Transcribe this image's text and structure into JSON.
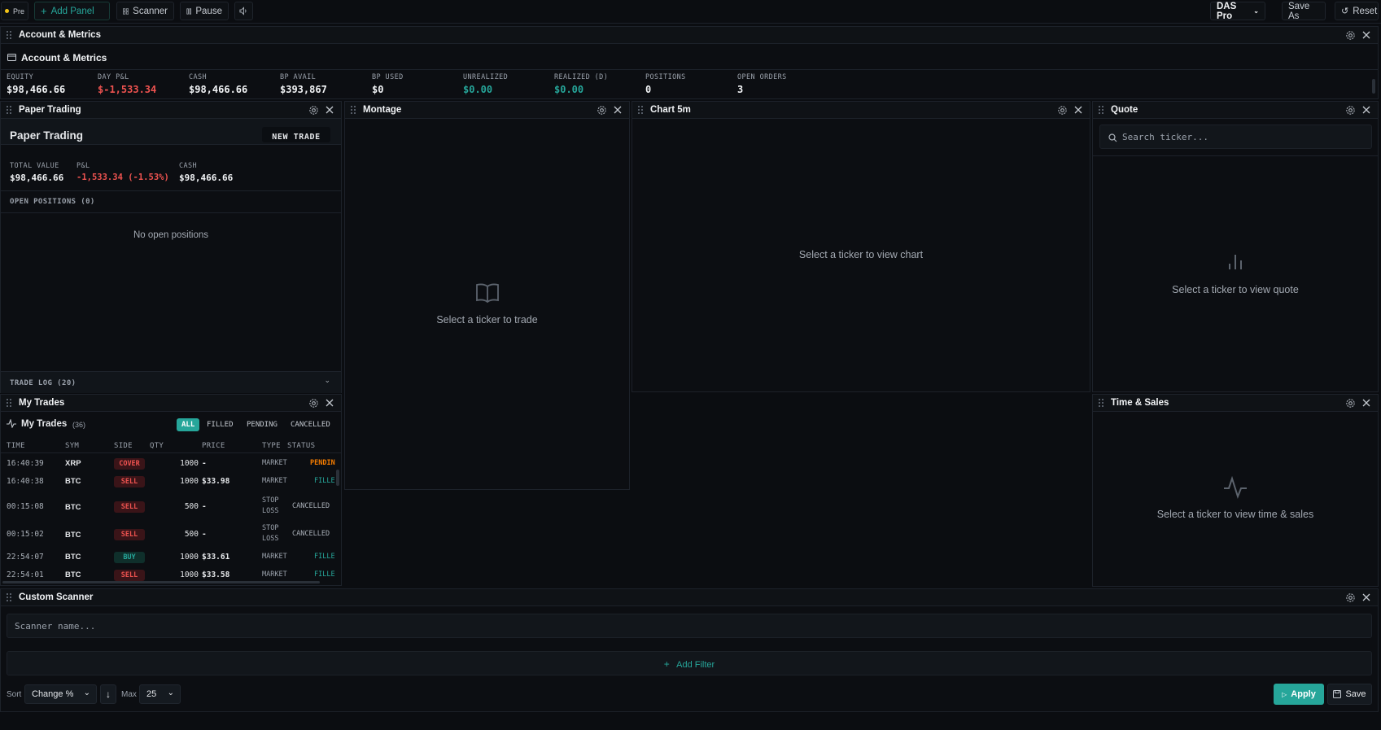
{
  "topbar": {
    "session": "Pre",
    "add_panel": "Add Panel",
    "scanner": "Scanner",
    "pause": "Pause",
    "layout": "DAS Pro",
    "save_as": "Save As",
    "reset": "Reset"
  },
  "account": {
    "panel_title": "Account & Metrics",
    "section_title": "Account & Metrics",
    "metrics": [
      {
        "label": "EQUITY",
        "value": "$98,466.66"
      },
      {
        "label": "DAY P&L",
        "value": "$-1,533.34"
      },
      {
        "label": "CASH",
        "value": "$98,466.66"
      },
      {
        "label": "BP AVAIL",
        "value": "$393,867"
      },
      {
        "label": "BP USED",
        "value": "$0"
      },
      {
        "label": "UNREALIZED",
        "value": "$0.00"
      },
      {
        "label": "REALIZED (D)",
        "value": "$0.00"
      },
      {
        "label": "POSITIONS",
        "value": "0"
      },
      {
        "label": "OPEN ORDERS",
        "value": "3"
      }
    ]
  },
  "paper": {
    "panel_title": "Paper Trading",
    "title": "Paper Trading",
    "new_trade": "NEW TRADE",
    "total_value_label": "TOTAL VALUE",
    "total_value": "$98,466.66",
    "pnl_label": "P&L",
    "pnl": "-1,533.34 (-1.53%)",
    "cash_label": "CASH",
    "cash": "$98,466.66",
    "open_positions": "OPEN POSITIONS (0)",
    "no_positions": "No open positions",
    "trade_log": "TRADE LOG (20)"
  },
  "montage": {
    "panel_title": "Montage",
    "empty": "Select a ticker to trade"
  },
  "chart": {
    "panel_title": "Chart 5m",
    "empty": "Select a ticker to view chart"
  },
  "quote": {
    "panel_title": "Quote",
    "search_placeholder": "Search ticker...",
    "empty": "Select a ticker to view quote"
  },
  "timesales": {
    "panel_title": "Time & Sales",
    "empty": "Select a ticker to view time & sales"
  },
  "mytrades": {
    "panel_title": "My Trades",
    "title": "My Trades",
    "count": "(36)",
    "filters": [
      "ALL",
      "FILLED",
      "PENDING",
      "CANCELLED"
    ],
    "columns": [
      "TIME",
      "SYM",
      "SIDE",
      "QTY",
      "PRICE",
      "TYPE",
      "STATUS"
    ],
    "rows": [
      {
        "time": "16:40:39",
        "sym": "XRP",
        "side": "COVER",
        "qty": "1000",
        "price": "-",
        "type": "MARKET",
        "type2": "",
        "status": "PENDIN"
      },
      {
        "time": "16:40:38",
        "sym": "BTC",
        "side": "SELL",
        "qty": "1000",
        "price": "$33.98",
        "type": "MARKET",
        "type2": "",
        "status": "FILLE"
      },
      {
        "time": "00:15:08",
        "sym": "BTC",
        "side": "SELL",
        "qty": "500",
        "price": "-",
        "type": "STOP",
        "type2": "LOSS",
        "status": "CANCELLED"
      },
      {
        "time": "00:15:02",
        "sym": "BTC",
        "side": "SELL",
        "qty": "500",
        "price": "-",
        "type": "STOP",
        "type2": "LOSS",
        "status": "CANCELLED"
      },
      {
        "time": "22:54:07",
        "sym": "BTC",
        "side": "BUY",
        "qty": "1000",
        "price": "$33.61",
        "type": "MARKET",
        "type2": "",
        "status": "FILLE"
      },
      {
        "time": "22:54:01",
        "sym": "BTC",
        "side": "SELL",
        "qty": "1000",
        "price": "$33.58",
        "type": "MARKET",
        "type2": "",
        "status": "FILLE"
      }
    ]
  },
  "scanner": {
    "panel_title": "Custom Scanner",
    "name_placeholder": "Scanner name...",
    "add_filter": "Add Filter",
    "sort_label": "Sort",
    "sort_value": "Change %",
    "max_label": "Max",
    "max_value": "25",
    "apply": "Apply",
    "save": "Save"
  },
  "colors": {
    "accent": "#26a69a",
    "negative": "#ef5350",
    "pending": "#f57c00",
    "background": "#0b0d11"
  }
}
